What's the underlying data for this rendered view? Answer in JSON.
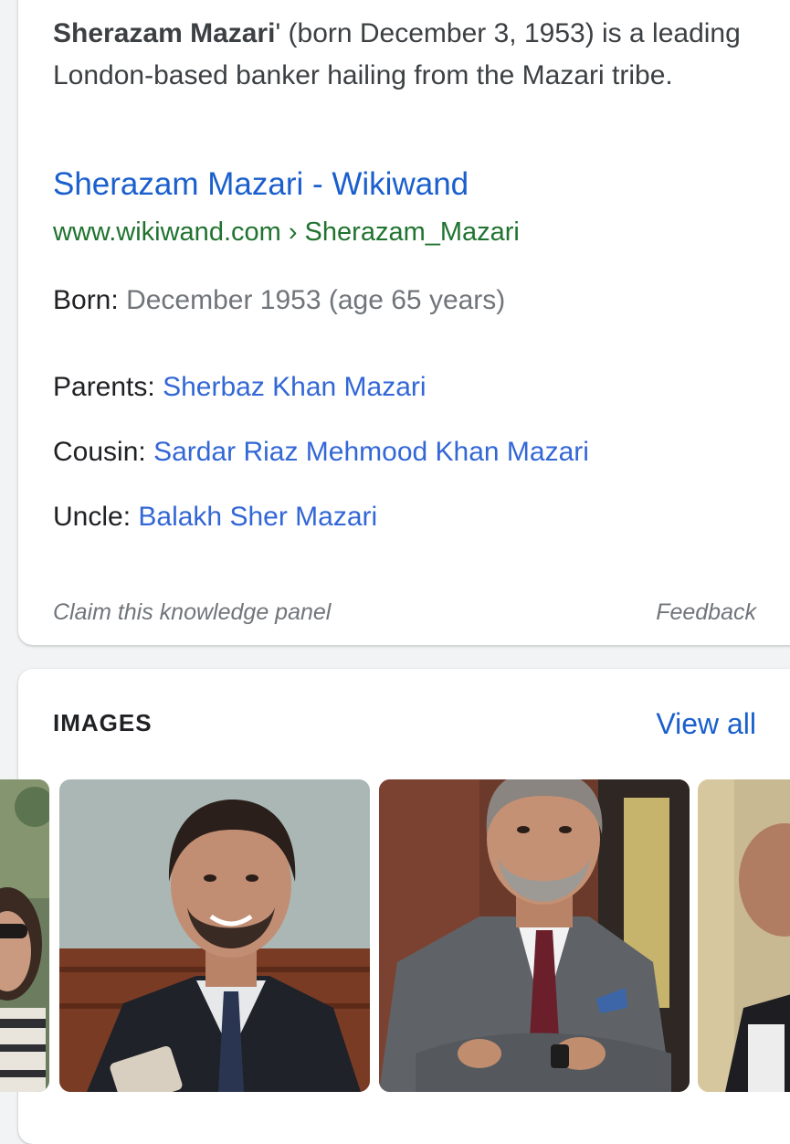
{
  "panel": {
    "description": {
      "name": "Sherazam Mazari",
      "rest": "' (born December 3, 1953) is a leading London-based banker hailing from the Mazari tribe."
    },
    "source": {
      "title": "Sherazam Mazari - Wikiwand",
      "url": "www.wikiwand.com › Sherazam_Mazari"
    },
    "facts": [
      {
        "label": "Born:",
        "value": "December 1953 (age 65 years)",
        "link": false
      },
      {
        "label": "Parents:",
        "value": "Sherbaz Khan Mazari",
        "link": true
      },
      {
        "label": "Cousin:",
        "value": "Sardar Riaz Mehmood Khan Mazari",
        "link": true
      },
      {
        "label": "Uncle:",
        "value": "Balakh Sher Mazari",
        "link": true
      }
    ],
    "footer": {
      "claim": "Claim this knowledge panel",
      "feedback": "Feedback"
    }
  },
  "images": {
    "heading": "IMAGES",
    "view_all": "View all",
    "thumbnails": [
      {
        "alt": "woman-with-sunglasses-photo"
      },
      {
        "alt": "man-smiling-portrait-photo"
      },
      {
        "alt": "man-in-grey-suit-arms-crossed-photo"
      },
      {
        "alt": "partial-photo"
      }
    ]
  },
  "colors": {
    "link_blue": "#1a5fcd",
    "url_green": "#20732f",
    "muted_grey": "#70757a",
    "text": "#202124"
  }
}
